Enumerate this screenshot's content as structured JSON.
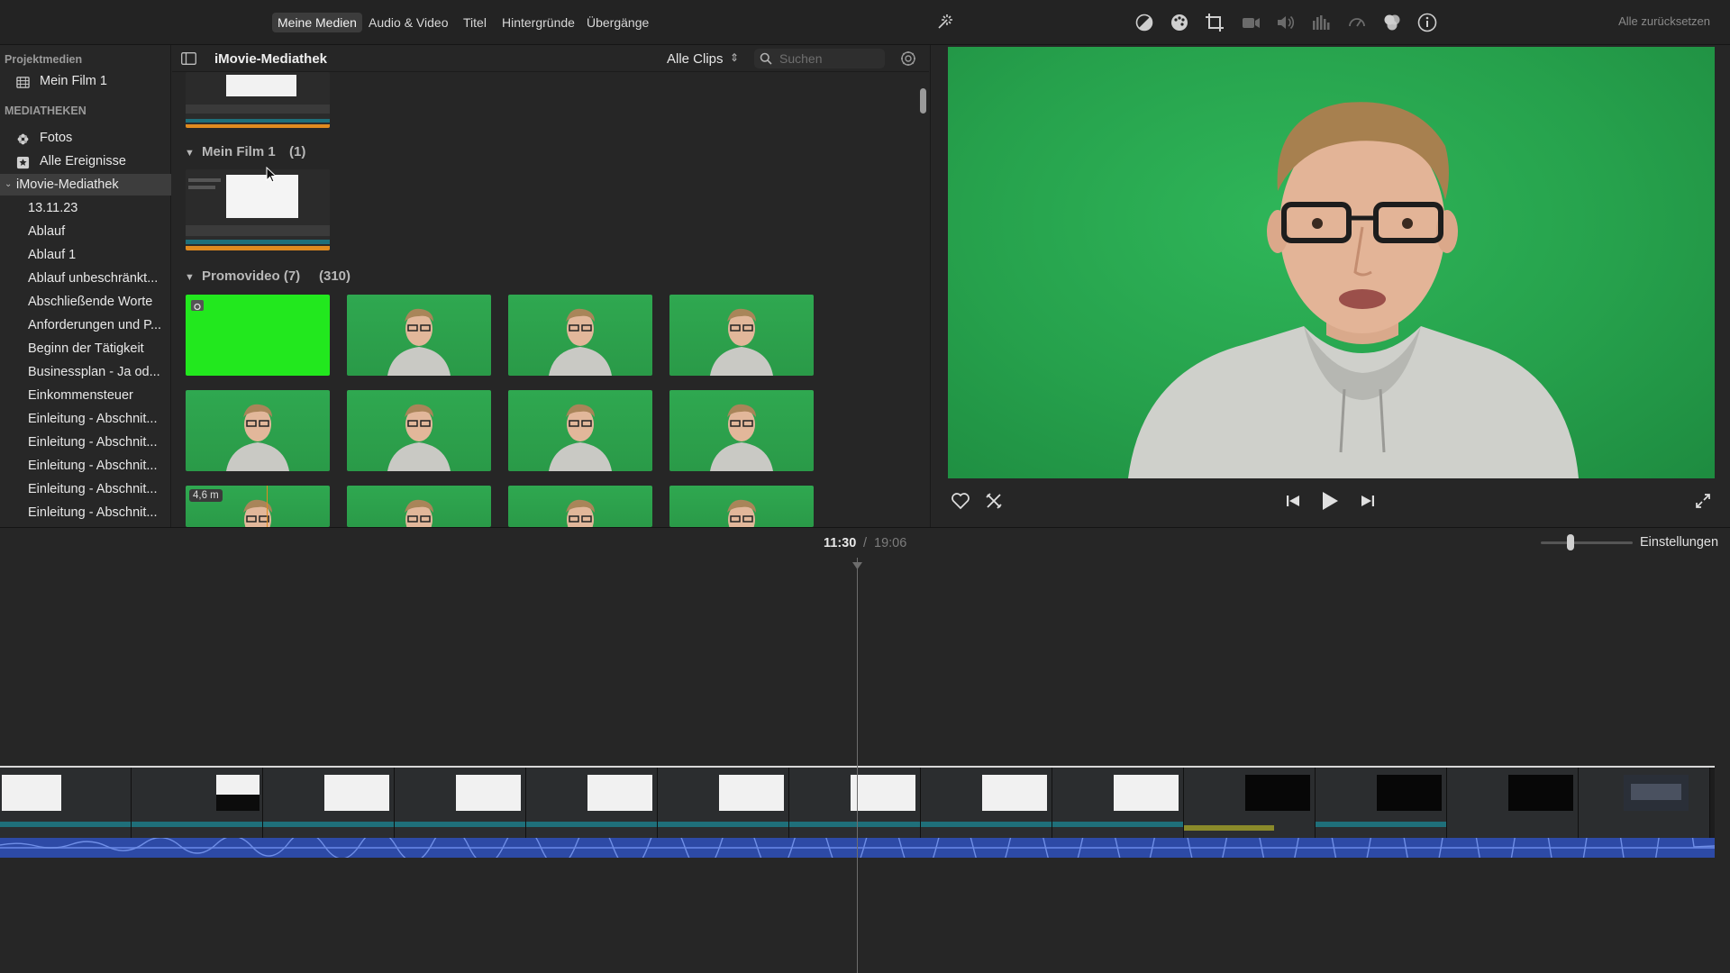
{
  "toolbar": {
    "tabs": [
      "Meine Medien",
      "Audio & Video",
      "Titel",
      "Hintergründe",
      "Übergänge"
    ],
    "active_tab": "Meine Medien",
    "reset_all": "Alle zurücksetzen",
    "icons": [
      "magic-wand-icon",
      "color-balance-icon",
      "color-correction-icon",
      "crop-icon",
      "stabilization-icon",
      "volume-icon",
      "equalizer-icon",
      "speed-icon",
      "clip-filter-icon",
      "info-icon"
    ]
  },
  "sidebar": {
    "project_heading": "Projektmedien",
    "project_item": "Mein Film 1",
    "libraries_heading": "MEDIATHEKEN",
    "photos": "Fotos",
    "all_events": "Alle Ereignisse",
    "library": "iMovie-Mediathek",
    "events": [
      "13.11.23",
      "Ablauf",
      "Ablauf 1",
      "Ablauf unbeschränkt...",
      "Abschließende Worte",
      "Anforderungen und P...",
      "Beginn der Tätigkeit",
      "Businessplan - Ja od...",
      "Einkommensteuer",
      "Einleitung - Abschnit...",
      "Einleitung - Abschnit...",
      "Einleitung - Abschnit...",
      "Einleitung - Abschnit...",
      "Einleitung - Abschnit..."
    ]
  },
  "browser": {
    "title": "iMovie-Mediathek",
    "filter": "Alle Clips",
    "search_placeholder": "Suchen",
    "section1_title": "Mein Film 1",
    "section1_count": "(1)",
    "section2_title": "Promovideo (7)",
    "section2_count": "(310)",
    "duration_badge": "4,6 m"
  },
  "viewer": {
    "current_time": "11:30",
    "separator": "/",
    "total_time": "19:06"
  },
  "timeline": {
    "settings_label": "Einstellungen"
  },
  "colors": {
    "green_screen": "#27a84f",
    "bright_green": "#22e81e",
    "audio_wave": "#2d4aa6"
  }
}
